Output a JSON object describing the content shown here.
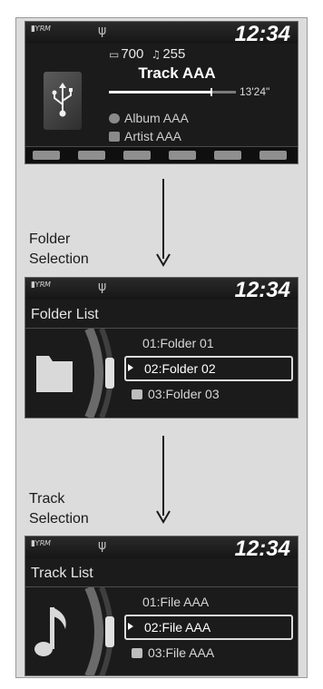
{
  "screen1": {
    "status": {
      "signal": "RM",
      "clock": "12:34"
    },
    "folder_count": "700",
    "track_count": "255",
    "track_title": "Track AAA",
    "progress_fraction": 0.8,
    "duration": "13'24\"",
    "album": "Album AAA",
    "artist": "Artist AAA"
  },
  "folder_step_label": "Folder\nSelection",
  "screen2": {
    "status": {
      "signal": "RM",
      "clock": "12:34"
    },
    "title": "Folder List",
    "items": [
      {
        "label": "01:Folder 01"
      },
      {
        "label": "02:Folder 02",
        "selected": true
      },
      {
        "label": "03:Folder 03"
      }
    ]
  },
  "track_step_label": "Track\nSelection",
  "screen3": {
    "status": {
      "signal": "RM",
      "clock": "12:34"
    },
    "title": "Track List",
    "items": [
      {
        "label": "01:File AAA"
      },
      {
        "label": "02:File AAA",
        "selected": true
      },
      {
        "label": "03:File AAA"
      }
    ]
  },
  "colors": {
    "screen_bg": "#1b1b1b",
    "frame_bg": "#dcdcdc",
    "text": "#ffffff"
  },
  "icons": [
    "signal-icon",
    "usb-icon",
    "folder-icon",
    "music-note-icon",
    "album-icon",
    "artist-icon"
  ]
}
